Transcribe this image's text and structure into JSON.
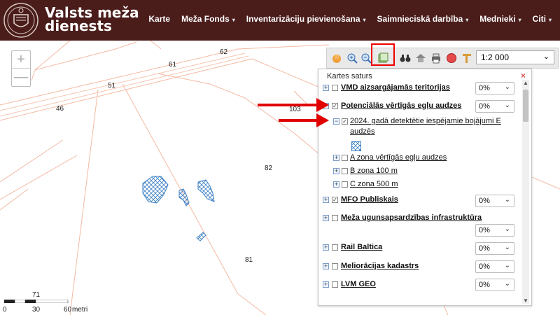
{
  "header": {
    "brand_line1": "Valsts meža",
    "brand_line2": "dienests",
    "nav": [
      {
        "label": "Karte",
        "dropdown": false
      },
      {
        "label": "Meža Fonds",
        "dropdown": true
      },
      {
        "label": "Inventarizāciju pievienošana",
        "dropdown": true
      },
      {
        "label": "Saimnieciskā darbība",
        "dropdown": true
      },
      {
        "label": "Mednieki",
        "dropdown": true
      },
      {
        "label": "Citi",
        "dropdown": true
      }
    ],
    "caret": "▾"
  },
  "map": {
    "zoom_in": "+",
    "zoom_out": "—",
    "parcel_numbers": [
      "62",
      "61",
      "51",
      "46",
      "103",
      "82",
      "81",
      "71"
    ],
    "colors": {
      "parcel_line": "#f4b9a2",
      "hatch": "#3b7fc4",
      "background": "#ffffff"
    }
  },
  "toolbar": {
    "icons": [
      "hand-icon",
      "zoom-in-icon",
      "zoom-out-icon",
      "layers-icon",
      "binoculars-icon",
      "home-icon",
      "print-icon",
      "stop-icon",
      "measure-icon"
    ],
    "scale_value": "1:2 000"
  },
  "panel": {
    "title": "Kartes saturs",
    "close": "×",
    "layers": {
      "vmd": {
        "label": "VMD aizsargājamās teritorijas",
        "opacity": "0%"
      },
      "potential": {
        "label": "Potenciālās vērtīgās egļu audzes",
        "opacity": "0%"
      },
      "detected": {
        "label_line1": "2024. gadā detektētie iespējamie bojājumi E",
        "label_line2": "audzēs"
      },
      "zone_a": {
        "label": "A zona vērtīgās egļu audzes"
      },
      "zone_b": {
        "label": "B zona 100 m"
      },
      "zone_c": {
        "label": "C zona 500 m"
      },
      "mfo": {
        "label": "MFO Publiskais",
        "opacity": "0%"
      },
      "fire": {
        "label": "Meža ugunsapsardzības infrastruktūra",
        "opacity": "0%"
      },
      "rail": {
        "label": "Rail Baltica",
        "opacity": "0%"
      },
      "melior": {
        "label": "Meliorācijas kadastrs",
        "opacity": "0%"
      },
      "lvm": {
        "label": "LVM GEO",
        "opacity": "0%"
      }
    },
    "expand_plus": "+",
    "expand_minus": "−",
    "check": "✓"
  },
  "scalebar": {
    "labels": [
      "0",
      "30",
      "60"
    ],
    "unit": "metri"
  },
  "annotations": {
    "arrow_color": "#e00000",
    "highlight_color": "#e00000"
  }
}
